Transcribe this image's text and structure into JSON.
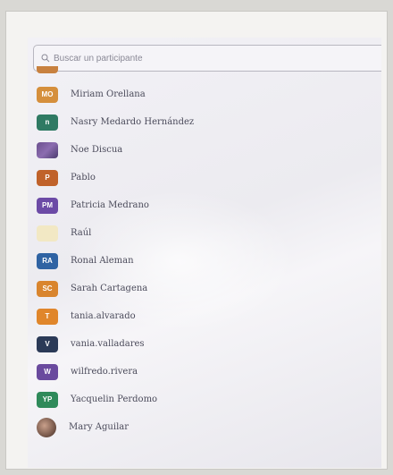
{
  "search": {
    "placeholder": "Buscar un participante"
  },
  "participants": [
    {
      "initials": "MO",
      "name": "Miriam Orellana",
      "color": "#d58f3c"
    },
    {
      "initials": "n",
      "name": "Nasry Medardo Hernández",
      "color": "#2f7a63"
    },
    {
      "initials": "",
      "name": "Noe Discua",
      "color": "#6b4f8e",
      "photo": true
    },
    {
      "initials": "P",
      "name": "Pablo",
      "color": "#c0622a"
    },
    {
      "initials": "PM",
      "name": "Patricia Medrano",
      "color": "#6c4aa6"
    },
    {
      "initials": "",
      "name": "Raúl",
      "color": "#f2e8c4"
    },
    {
      "initials": "RA",
      "name": "Ronal Aleman",
      "color": "#2f63a3"
    },
    {
      "initials": "SC",
      "name": "Sarah Cartagena",
      "color": "#d9852e"
    },
    {
      "initials": "T",
      "name": "tania.alvarado",
      "color": "#e0862b"
    },
    {
      "initials": "V",
      "name": "vania.valladares",
      "color": "#2b3a57"
    },
    {
      "initials": "W",
      "name": "wilfredo.rivera",
      "color": "#6a4a9e"
    },
    {
      "initials": "YP",
      "name": "Yacquelin Perdomo",
      "color": "#2f8a5a"
    },
    {
      "initials": "",
      "name": "Mary Aguilar",
      "color": "#7a5a4c",
      "photo": true
    }
  ]
}
